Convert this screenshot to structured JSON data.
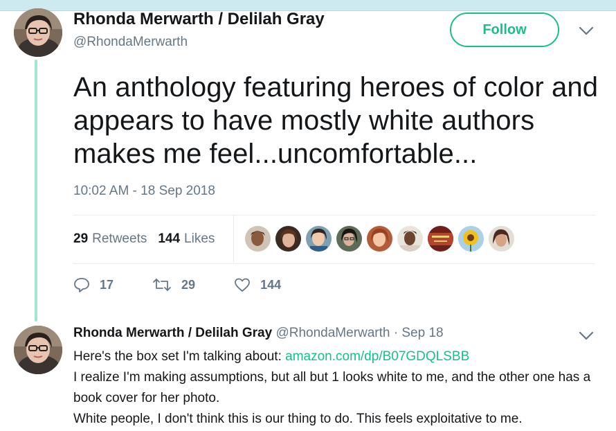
{
  "colors": {
    "accent": "#17bf8a",
    "thread_line": "#a3e3d2",
    "muted": "#657786",
    "text": "#14171a"
  },
  "tweet": {
    "author_name": "Rhonda Merwarth / Delilah Gray",
    "handle": "@RhondaMerwarth",
    "follow_label": "Follow",
    "text": "An anthology featuring heroes of color and appears to have mostly white authors makes me feel...uncomfortable...",
    "timestamp": "10:02 AM - 18 Sep 2018",
    "retweets_count": "29",
    "retweets_label": "Retweets",
    "likes_count": "144",
    "likes_label": "Likes",
    "actions": {
      "replies": "17",
      "retweets": "29",
      "likes": "144"
    },
    "icons": [
      "reply-icon",
      "retweet-icon",
      "like-icon",
      "chevron-down-icon"
    ]
  },
  "reply": {
    "author_name": "Rhonda Merwarth / Delilah Gray",
    "handle": "@RhondaMerwarth",
    "separator": "·",
    "date": "Sep 18",
    "line1_prefix": "Here's the box set I'm talking about: ",
    "link_text": "amazon.com/dp/B07GDQLSBB",
    "line2": "I realize I'm making assumptions, but all but 1 looks white to me, and the other one has a book cover for her photo.",
    "line3": "White people, I don't think this is our thing to do. This feels exploitative to me."
  }
}
